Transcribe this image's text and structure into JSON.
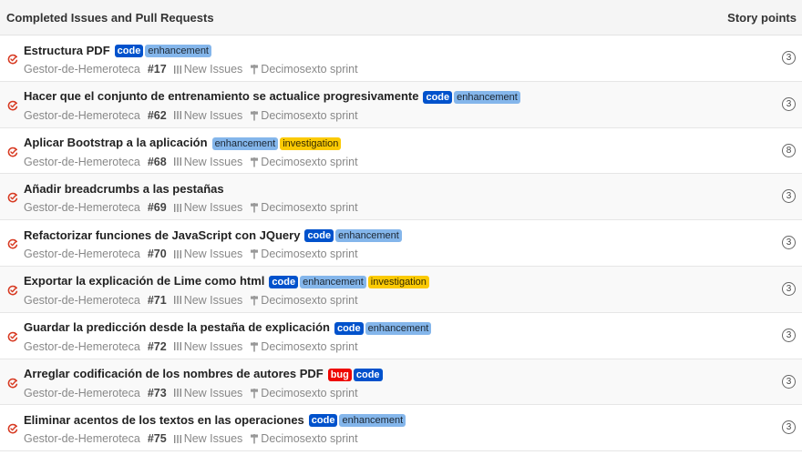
{
  "header": {
    "title": "Completed Issues and Pull Requests",
    "story_points_label": "Story points"
  },
  "colors": {
    "code": "#0052cc",
    "enhancement": "#84b6eb",
    "investigation": "#fbca04",
    "bug": "#ee0701",
    "closed_icon": "#d73a22"
  },
  "icons": {
    "status": "closed-issue-icon",
    "pipeline": "pipeline-icon",
    "milestone": "milestone-icon"
  },
  "issues": [
    {
      "title": "Estructura PDF",
      "labels": [
        "code",
        "enhancement"
      ],
      "repo": "Gestor-de-Hemeroteca",
      "number": "#17",
      "pipeline": "New Issues",
      "milestone": "Decimosexto sprint",
      "points": "3"
    },
    {
      "title": "Hacer que el conjunto de entrenamiento se actualice progresivamente",
      "labels": [
        "code",
        "enhancement"
      ],
      "repo": "Gestor-de-Hemeroteca",
      "number": "#62",
      "pipeline": "New Issues",
      "milestone": "Decimosexto sprint",
      "points": "3"
    },
    {
      "title": "Aplicar Bootstrap a la aplicación",
      "labels": [
        "enhancement",
        "investigation"
      ],
      "repo": "Gestor-de-Hemeroteca",
      "number": "#68",
      "pipeline": "New Issues",
      "milestone": "Decimosexto sprint",
      "points": "8"
    },
    {
      "title": "Añadir breadcrumbs a las pestañas",
      "labels": [],
      "repo": "Gestor-de-Hemeroteca",
      "number": "#69",
      "pipeline": "New Issues",
      "milestone": "Decimosexto sprint",
      "points": "3"
    },
    {
      "title": "Refactorizar funciones de JavaScript con JQuery",
      "labels": [
        "code",
        "enhancement"
      ],
      "repo": "Gestor-de-Hemeroteca",
      "number": "#70",
      "pipeline": "New Issues",
      "milestone": "Decimosexto sprint",
      "points": "3"
    },
    {
      "title": "Exportar la explicación de Lime como html",
      "labels": [
        "code",
        "enhancement",
        "investigation"
      ],
      "repo": "Gestor-de-Hemeroteca",
      "number": "#71",
      "pipeline": "New Issues",
      "milestone": "Decimosexto sprint",
      "points": "3"
    },
    {
      "title": "Guardar la predicción desde la pestaña de explicación",
      "labels": [
        "code",
        "enhancement"
      ],
      "repo": "Gestor-de-Hemeroteca",
      "number": "#72",
      "pipeline": "New Issues",
      "milestone": "Decimosexto sprint",
      "points": "3"
    },
    {
      "title": "Arreglar codificación de los nombres de autores PDF",
      "labels": [
        "bug",
        "code"
      ],
      "repo": "Gestor-de-Hemeroteca",
      "number": "#73",
      "pipeline": "New Issues",
      "milestone": "Decimosexto sprint",
      "points": "3"
    },
    {
      "title": "Eliminar acentos de los textos en las operaciones",
      "labels": [
        "code",
        "enhancement"
      ],
      "repo": "Gestor-de-Hemeroteca",
      "number": "#75",
      "pipeline": "New Issues",
      "milestone": "Decimosexto sprint",
      "points": "3"
    }
  ]
}
